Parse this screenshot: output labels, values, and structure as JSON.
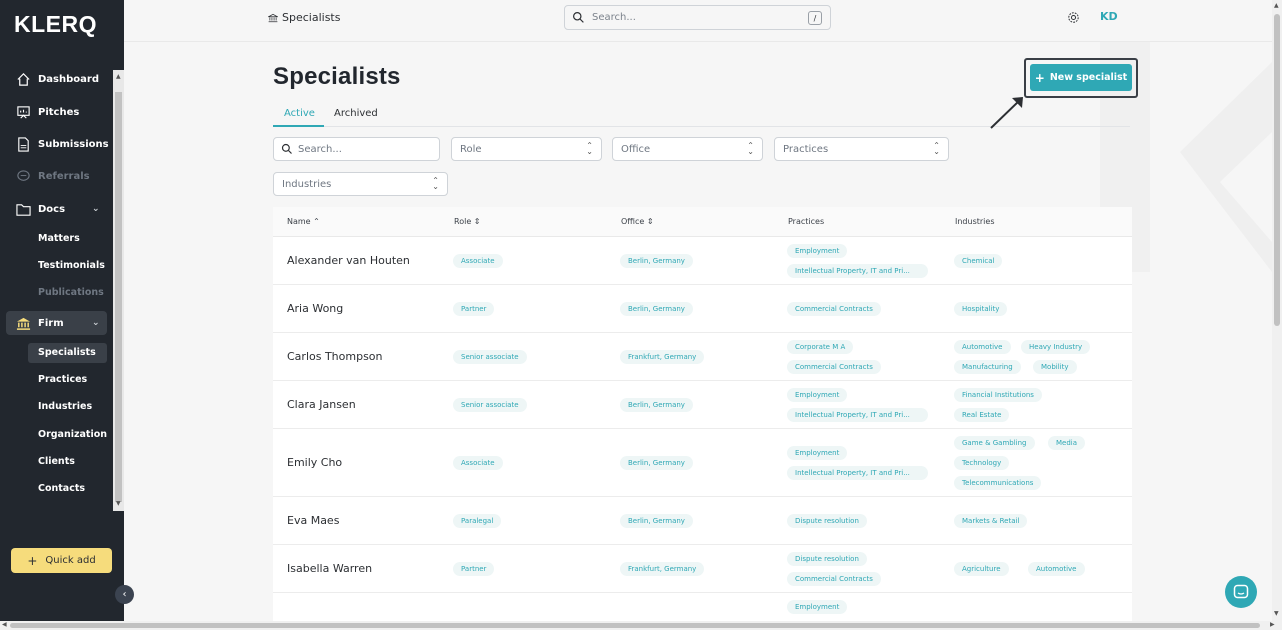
{
  "app": {
    "logo": "KLERQ"
  },
  "sidebar": {
    "items": [
      {
        "label": "Dashboard",
        "icon": "home-icon"
      },
      {
        "label": "Pitches",
        "icon": "presentation-icon"
      },
      {
        "label": "Submissions",
        "icon": "file-icon"
      },
      {
        "label": "Referrals",
        "icon": "chat-icon"
      },
      {
        "label": "Docs",
        "icon": "folder-icon"
      },
      {
        "label": "Firm",
        "icon": "bank-icon"
      }
    ],
    "docs_children": [
      "Matters",
      "Testimonials",
      "Publications"
    ],
    "firm_children": [
      "Specialists",
      "Practices",
      "Industries",
      "Organization",
      "Clients",
      "Contacts"
    ],
    "quick_add": "Quick add",
    "quick_add_plus": "+"
  },
  "topbar": {
    "breadcrumb": "Specialists",
    "search_placeholder": "Search...",
    "search_shortcut": "/",
    "avatar": "KD"
  },
  "page": {
    "title": "Specialists",
    "tabs": [
      "Active",
      "Archived"
    ],
    "new_button": "New specialist",
    "new_button_plus": "+",
    "filters": {
      "search": "Search...",
      "role": "Role",
      "office": "Office",
      "practices": "Practices",
      "industries": "Industries"
    }
  },
  "table": {
    "columns": [
      "Name ⌃",
      "Role ⇕",
      "Office ⇕",
      "Practices",
      "Industries"
    ],
    "rows": [
      {
        "name": "Alexander van Houten",
        "role": "Associate",
        "office": "Berlin, Germany",
        "practices": [
          "Employment",
          "Intellectual Property, IT and Pri..."
        ],
        "industries": [
          [
            "Chemical"
          ]
        ]
      },
      {
        "name": "Aria Wong",
        "role": "Partner",
        "office": "Berlin, Germany",
        "practices": [
          "Commercial Contracts"
        ],
        "industries": [
          [
            "Hospitality"
          ]
        ]
      },
      {
        "name": "Carlos Thompson",
        "role": "Senior associate",
        "office": "Frankfurt, Germany",
        "practices": [
          "Corporate M A",
          "Commercial Contracts"
        ],
        "industries": [
          [
            "Automotive",
            "Heavy Industry"
          ],
          [
            "Manufacturing",
            "Mobility"
          ]
        ]
      },
      {
        "name": "Clara Jansen",
        "role": "Senior associate",
        "office": "Berlin, Germany",
        "practices": [
          "Employment",
          "Intellectual Property, IT and Pri..."
        ],
        "industries": [
          [
            "Financial Institutions"
          ],
          [
            "Real Estate"
          ]
        ]
      },
      {
        "name": "Emily Cho",
        "role": "Associate",
        "office": "Berlin, Germany",
        "practices": [
          "Employment",
          "Intellectual Property, IT and Pri..."
        ],
        "industries": [
          [
            "Game & Gambling",
            "Media"
          ],
          [
            "Technology"
          ],
          [
            "Telecommunications"
          ]
        ]
      },
      {
        "name": "Eva Maes",
        "role": "Paralegal",
        "office": "Berlin, Germany",
        "practices": [
          "Dispute resolution"
        ],
        "industries": [
          [
            "Markets & Retail"
          ]
        ]
      },
      {
        "name": "Isabella Warren",
        "role": "Partner",
        "office": "Frankfurt, Germany",
        "practices": [
          "Dispute resolution",
          "Commercial Contracts"
        ],
        "industries": [
          [
            "Agriculture",
            "Automotive"
          ]
        ]
      },
      {
        "name": "",
        "role": "",
        "office": "",
        "practices": [
          "Employment"
        ],
        "industries": []
      }
    ]
  },
  "colors": {
    "accent": "#2fa8b5",
    "sidebar": "#22272e",
    "quick_add": "#f6dc7c"
  }
}
